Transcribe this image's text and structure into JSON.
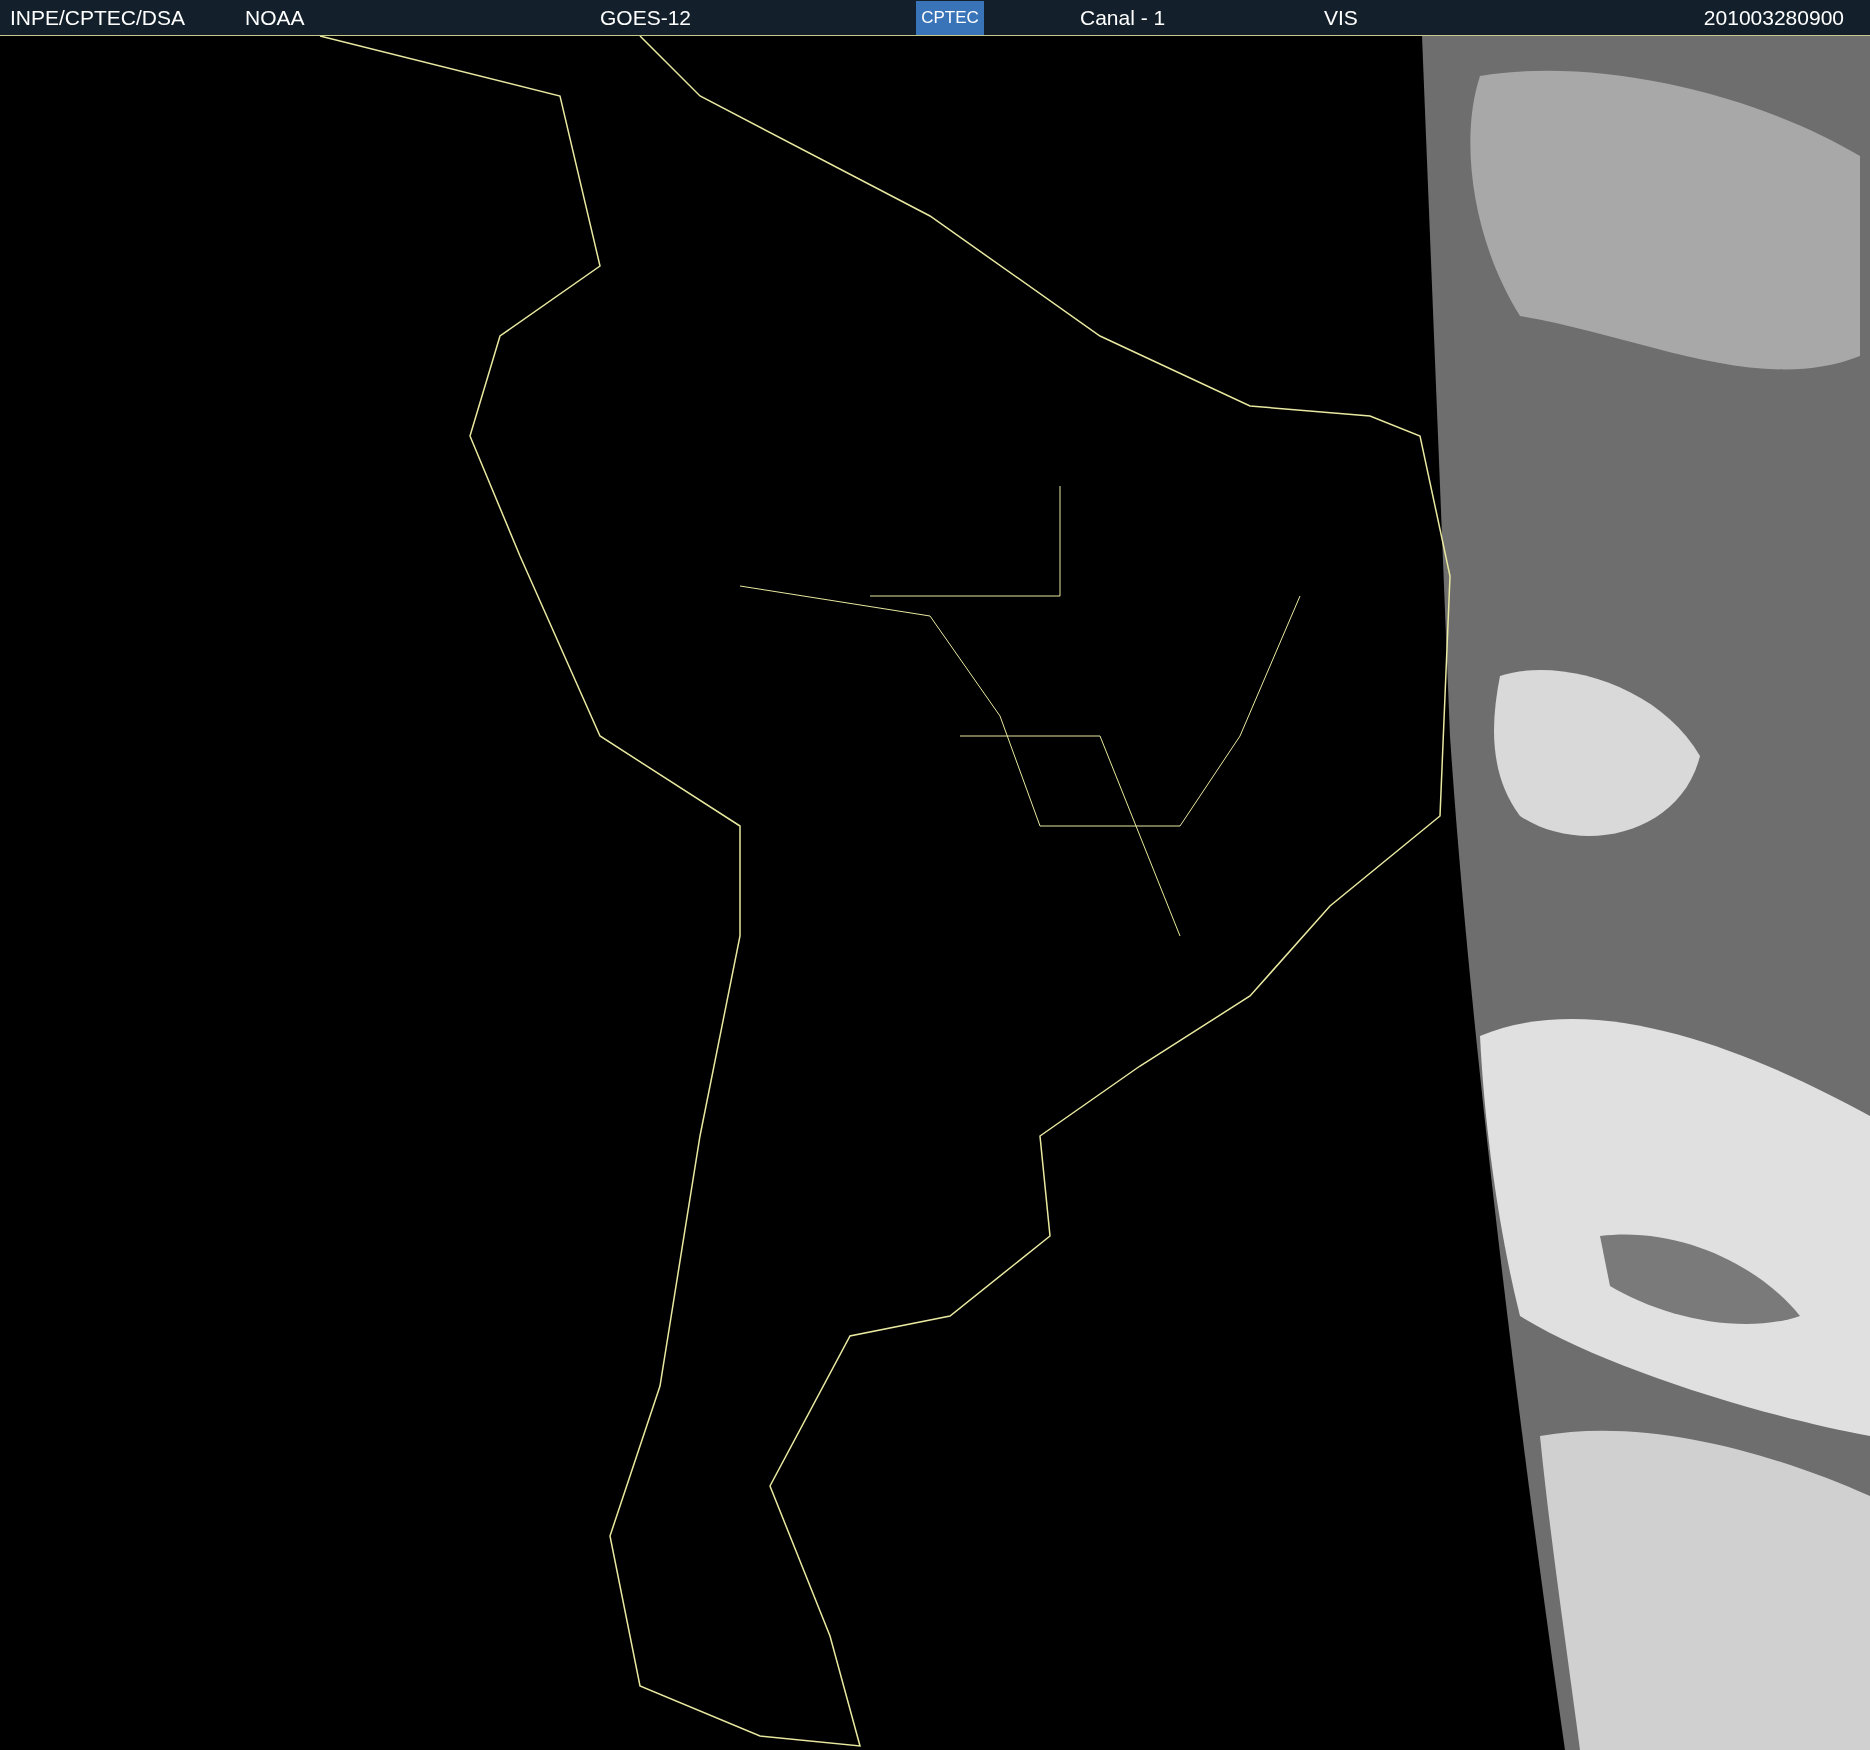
{
  "header": {
    "source": "INPE/CPTEC/DSA",
    "agency": "NOAA",
    "satellite": "GOES-12",
    "logo": "CPTEC",
    "channel": "Canal - 1",
    "band": "VIS",
    "timestamp": "201003280900"
  }
}
